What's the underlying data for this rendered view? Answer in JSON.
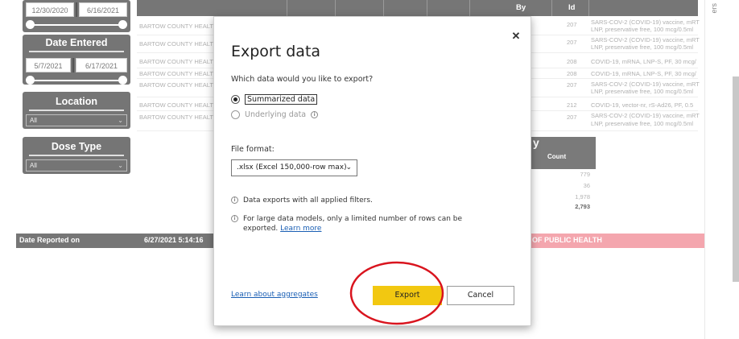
{
  "slicers": {
    "date_range_1": {
      "start": "12/30/2020",
      "end": "6/16/2021"
    },
    "date_entered": {
      "title": "Date Entered",
      "start": "5/7/2021",
      "end": "6/17/2021"
    },
    "location": {
      "title": "Location",
      "value": "All"
    },
    "dose_type": {
      "title": "Dose Type",
      "value": "All"
    }
  },
  "table": {
    "headers": {
      "by": "By",
      "id": "Id"
    },
    "rows": [
      {
        "org": "BARTOW COUNTY HEALTH",
        "id": "207",
        "vaccine1": "SARS-COV-2 (COVID-19) vaccine, mRT",
        "vaccine2": "LNP, preservative free, 100 mcg/0.5ml"
      },
      {
        "org": "BARTOW COUNTY HEALTH",
        "id": "207",
        "vaccine1": "SARS-COV-2 (COVID-19) vaccine, mRT",
        "vaccine2": "LNP, preservative free, 100 mcg/0.5ml"
      },
      {
        "org": "BARTOW COUNTY HEALTH",
        "id": "208",
        "vaccine1": "COVID-19, mRNA, LNP-S, PF, 30 mcg/",
        "vaccine2": ""
      },
      {
        "org": "BARTOW COUNTY HEALTH",
        "id": "208",
        "vaccine1": "COVID-19, mRNA, LNP-S, PF, 30 mcg/",
        "vaccine2": ""
      },
      {
        "org": "BARTOW COUNTY HEALTH",
        "id": "207",
        "vaccine1": "SARS-COV-2 (COVID-19) vaccine, mRT",
        "vaccine2": "LNP, preservative free, 100 mcg/0.5ml"
      },
      {
        "org": "BARTOW COUNTY HEALTH",
        "id": "212",
        "vaccine1": "COVID-19, vector-nr, rS-Ad26, PF, 0.5",
        "vaccine2": ""
      },
      {
        "org": "BARTOW COUNTY HEALTH",
        "id": "207",
        "vaccine1": "SARS-COV-2 (COVID-19) vaccine, mRT",
        "vaccine2": "LNP, preservative free, 100 mcg/0.5ml"
      }
    ]
  },
  "summary": {
    "header_letter": "y",
    "count_label": "Count",
    "counts": [
      "779",
      "36",
      "1,978"
    ],
    "total": "2,793"
  },
  "bottom": {
    "date_reported_label": "Date Reported on",
    "date_reported_value": "6/27/2021 5:14:16",
    "dept_fragment": "OF PUBLIC HEALTH"
  },
  "right_panel": {
    "label": "ers"
  },
  "dialog": {
    "title": "Export data",
    "question": "Which data would you like to export?",
    "options": [
      "Summarized data",
      "Underlying data"
    ],
    "format_label": "File format:",
    "format_value": ".xlsx (Excel 150,000-row max)",
    "note1": "Data exports with all applied filters.",
    "note2_text": "For large data models, only a limited number of rows can be exported.",
    "note2_link": "Learn more",
    "learn_aggregates": "Learn about aggregates",
    "export_label": "Export",
    "cancel_label": "Cancel",
    "close_glyph": "✕",
    "info_glyph": "i",
    "chevron_glyph": "⌄"
  },
  "colors": {
    "accent_yellow": "#f2c811",
    "annotation_red": "#d9141e",
    "slicer_gray": "#757575",
    "link_blue": "#1a5fb4"
  }
}
